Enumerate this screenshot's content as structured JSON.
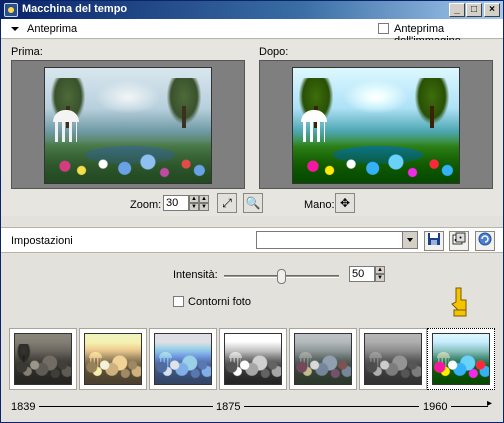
{
  "window": {
    "title": "Macchina del tempo"
  },
  "title_buttons": {
    "minimize": "_",
    "maximize": "□",
    "close": "×"
  },
  "preview_header": {
    "toggle_label": "Anteprima",
    "image_preview_label": "Anteprima dell'immagine"
  },
  "preview": {
    "before_label": "Prima:",
    "after_label": "Dopo:"
  },
  "zoom": {
    "label": "Zoom:",
    "value": "30",
    "pan_label": "Mano:"
  },
  "settings": {
    "label": "Impostazioni",
    "preset_value": ""
  },
  "controls": {
    "intensity_label": "Intensità:",
    "intensity_value": "50",
    "intensity_level": 0.5,
    "photo_edges_label": "Contorni foto"
  },
  "timeline": {
    "years": [
      "1839",
      "1875",
      "1960"
    ],
    "selected_index": 6
  },
  "colors": {
    "titlebar": "#0a246a",
    "selection": "#0a246a",
    "hand_pointer": "#f4c400"
  }
}
